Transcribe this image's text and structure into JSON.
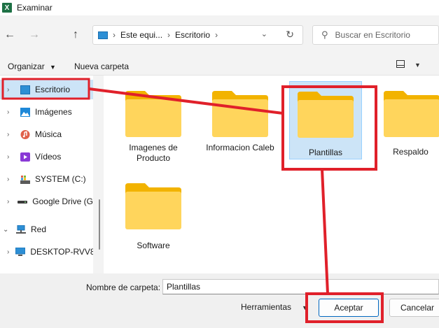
{
  "window": {
    "title": "Examinar",
    "app_icon_letter": "X",
    "app_icon_color": "#1e7145"
  },
  "nav": {
    "back_icon": "arrow-left-icon",
    "forward_icon": "arrow-right-icon",
    "up_icon": "arrow-up-icon",
    "address": {
      "segments": [
        "Este equi...",
        "Escritorio"
      ]
    },
    "search": {
      "placeholder": "Buscar en Escritorio"
    }
  },
  "toolbar": {
    "organize_label": "Organizar",
    "new_folder_label": "Nueva carpeta"
  },
  "sidebar": {
    "items": [
      {
        "label": "Escritorio",
        "icon": "desktop-icon",
        "color": "#2d8fd5",
        "selected": true
      },
      {
        "label": "Imágenes",
        "icon": "pictures-icon",
        "color": "#1e88d8"
      },
      {
        "label": "Música",
        "icon": "music-icon",
        "color": "#e0604a"
      },
      {
        "label": "Vídeos",
        "icon": "videos-icon",
        "color": "#8a3ad6"
      },
      {
        "label": "SYSTEM (C:)",
        "icon": "drive-icon",
        "color": "#5a5a5a"
      },
      {
        "label": "Google Drive (G",
        "icon": "drive-icon",
        "color": "#3a3a3a"
      },
      {
        "label": "Red",
        "icon": "network-icon",
        "color": "#2d8fd5"
      },
      {
        "label": "DESKTOP-RVV8",
        "icon": "computer-icon",
        "color": "#2d8fd5"
      }
    ]
  },
  "folders": [
    {
      "label": "Imagenes de Producto"
    },
    {
      "label": "Informacion Caleb"
    },
    {
      "label": "Plantillas",
      "selected": true
    },
    {
      "label": "Respaldo"
    },
    {
      "label": "Software"
    }
  ],
  "bottom": {
    "folder_name_label": "Nombre de carpeta:",
    "folder_name_value": "Plantillas",
    "tools_label": "Herramientas",
    "accept_label": "Aceptar",
    "cancel_label": "Cancelar"
  },
  "colors": {
    "selection": "#cce4f7",
    "annotation": "#e0202a",
    "folder_body": "#ffd55c",
    "folder_tab": "#f2b300"
  }
}
